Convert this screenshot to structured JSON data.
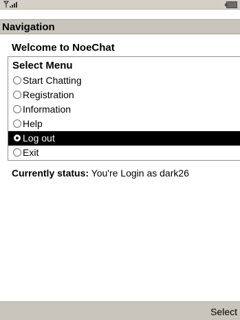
{
  "status_bar": {
    "signal_icon": "signal-strength-icon",
    "battery_icon": "battery-icon"
  },
  "title_bar": {
    "title": "Navigation"
  },
  "welcome_text": "Welcome to NoeChat",
  "menu": {
    "title": "Select Menu",
    "selected_index": 4,
    "items": [
      {
        "label": "Start Chatting"
      },
      {
        "label": "Registration"
      },
      {
        "label": "Information"
      },
      {
        "label": "Help"
      },
      {
        "label": "Log out"
      },
      {
        "label": "Exit"
      }
    ]
  },
  "status": {
    "label": "Currently status:",
    "value": "You're Login as dark26"
  },
  "softkeys": {
    "right_label": "Select"
  },
  "colors": {
    "selection_bg": "#000000",
    "selection_fg": "#ffffff",
    "bar_bg": "#c9c5bd"
  }
}
